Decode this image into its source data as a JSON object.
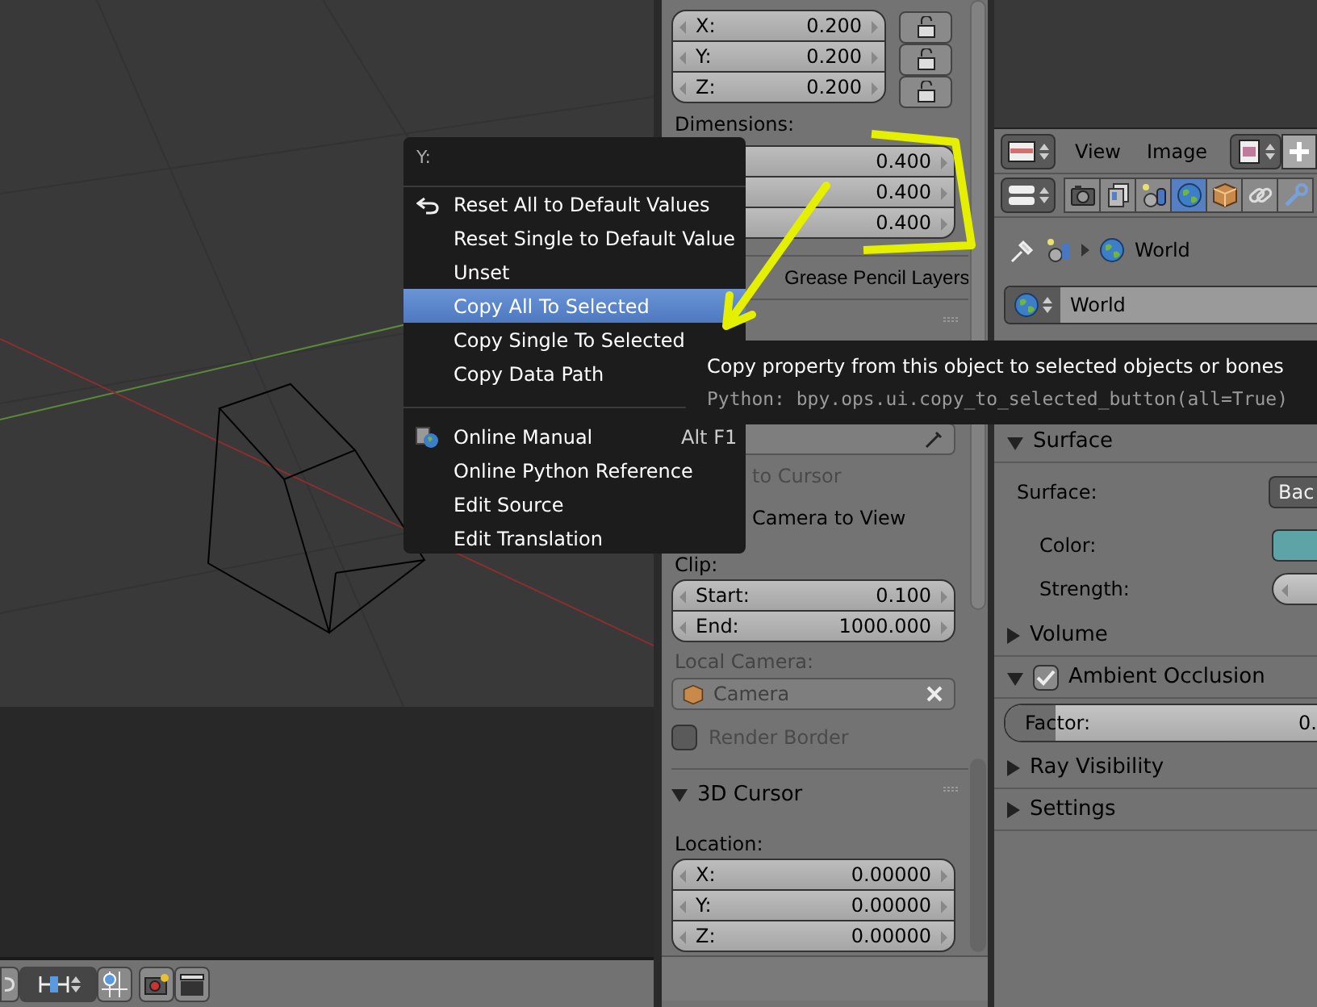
{
  "transform_panel": {
    "scale_fields": [
      {
        "label": "X:",
        "value": "0.200",
        "locked": false
      },
      {
        "label": "Y:",
        "value": "0.200",
        "locked": false
      },
      {
        "label": "Z:",
        "value": "0.200",
        "locked": false
      }
    ],
    "dimensions_label": "Dimensions:",
    "dimension_fields": [
      {
        "value": "0.400"
      },
      {
        "value": "0.400"
      },
      {
        "value": "0.400"
      }
    ]
  },
  "grease_pencil": {
    "title": "Grease Pencil Layers"
  },
  "view_panel": {
    "checkboxes": [
      {
        "label": "to Cursor",
        "disabled": true
      },
      {
        "label": "Camera to View",
        "disabled": false
      }
    ],
    "clip_label": "Clip:",
    "clip_fields": [
      {
        "label": "Start:",
        "value": "0.100"
      },
      {
        "label": "End:",
        "value": "1000.000"
      }
    ],
    "local_camera_label": "Local Camera:",
    "local_camera": {
      "value": "Camera",
      "disabled": true
    },
    "render_border": {
      "label": "Render Border",
      "checked": false,
      "disabled": true
    }
  },
  "cursor_panel": {
    "title": "3D Cursor",
    "expanded": true,
    "location_label": "Location:",
    "fields": [
      {
        "label": "X:",
        "value": "0.00000"
      },
      {
        "label": "Y:",
        "value": "0.00000"
      },
      {
        "label": "Z:",
        "value": "0.00000"
      }
    ]
  },
  "image_header": {
    "menus": [
      "View",
      "Image"
    ]
  },
  "properties": {
    "tabs": [
      {
        "kind": "render",
        "selected": false
      },
      {
        "kind": "layers",
        "selected": false
      },
      {
        "kind": "scene",
        "selected": false
      },
      {
        "kind": "world",
        "selected": true
      },
      {
        "kind": "object",
        "selected": false
      },
      {
        "kind": "constraints",
        "selected": false
      },
      {
        "kind": "modifiers",
        "selected": false
      }
    ],
    "breadcrumb": "World",
    "world_field": "World",
    "sections": [
      {
        "title": "Surface",
        "expanded": true,
        "rows": [
          {
            "kind": "dropdown",
            "label": "Surface:",
            "value": "Bac"
          },
          {
            "kind": "color",
            "label": "Color:",
            "color": "#5ea3a6"
          },
          {
            "kind": "slider",
            "label": "Strength:"
          }
        ]
      },
      {
        "title": "Volume",
        "expanded": false
      },
      {
        "title": "Ambient Occlusion",
        "expanded": true,
        "checked": true,
        "rows": [
          {
            "kind": "factor",
            "label": "Factor:",
            "value": "0.",
            "level": 0.16
          }
        ]
      },
      {
        "title": "Ray Visibility",
        "expanded": false
      },
      {
        "title": "Settings",
        "expanded": false
      }
    ]
  },
  "context_menu": {
    "title": "Y:",
    "groups": [
      [
        {
          "kind": "reset",
          "label": "Reset All to Default Values",
          "selected": false
        },
        {
          "kind": "plain",
          "label": "Reset Single to Default Value",
          "selected": false
        },
        {
          "kind": "plain",
          "label": "Unset",
          "selected": false
        },
        {
          "kind": "plain",
          "label": "Copy All To Selected",
          "selected": true
        },
        {
          "kind": "plain",
          "label": "Copy Single To Selected",
          "selected": false
        },
        {
          "kind": "plain",
          "label": "Copy Data Path",
          "selected": false
        }
      ],
      [
        {
          "kind": "manual",
          "label": "Online Manual",
          "shortcut": "Alt F1",
          "selected": false
        },
        {
          "kind": "plain",
          "label": "Online Python Reference",
          "selected": false
        },
        {
          "kind": "plain",
          "label": "Edit Source",
          "selected": false
        },
        {
          "kind": "plain",
          "label": "Edit Translation",
          "selected": false
        }
      ]
    ]
  },
  "tooltip": {
    "text": "Copy property from this object to selected objects or bones",
    "python": "Python: bpy.ops.ui.copy_to_selected_button(all=True)"
  }
}
